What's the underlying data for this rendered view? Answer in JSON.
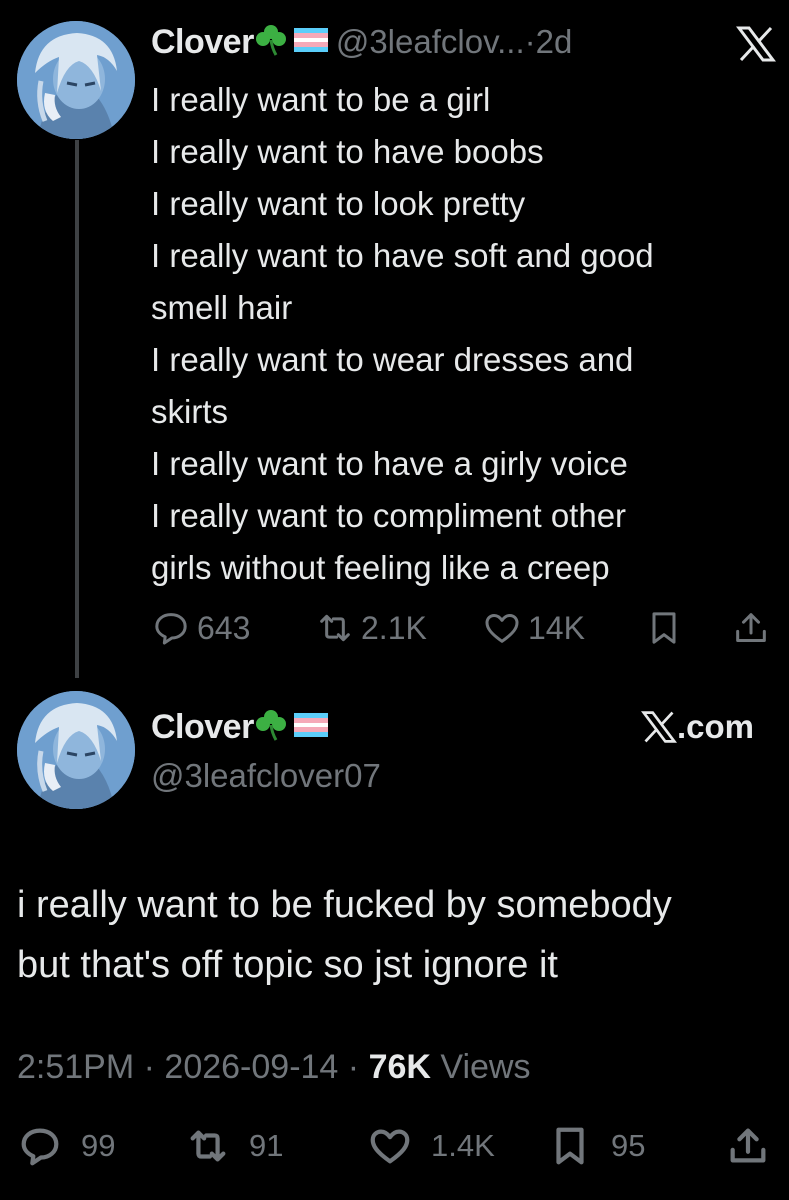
{
  "reply": {
    "author_name": "Clover",
    "handle": "@3leafclov...",
    "time": "2d",
    "lines": [
      "I really want to be a girl",
      "I really want to have boobs",
      "I really want to look pretty",
      "I really want to have soft and good",
      "smell hair",
      "I really want to wear dresses and",
      "skirts",
      "I really want to have a girly voice",
      "I really want to compliment other",
      "girls without feeling like a creep"
    ],
    "actions": {
      "replies": "643",
      "reposts": "2.1K",
      "likes": "14K"
    }
  },
  "main": {
    "author_name": "Clover",
    "handle": "@3leafclover07",
    "site_label": ".com",
    "lines": [
      "i really want to be fucked by somebody",
      "but that's off topic so jst ignore it"
    ],
    "time": "2:51PM",
    "date": "2026-09-14",
    "views_count": "76K",
    "views_label": "Views",
    "actions": {
      "replies": "99",
      "reposts": "91",
      "likes": "1.4K",
      "bookmarks": "95"
    }
  },
  "icons": {
    "reply": "speech-bubble-icon",
    "repost": "repost-arrows-icon",
    "like": "heart-icon",
    "bookmark": "bookmark-icon",
    "share": "share-icon",
    "brand": "x-logo-icon",
    "emoji": [
      "shamrock-icon",
      "trans-flag-icon"
    ]
  },
  "colors": {
    "background": "#000000",
    "text": "#e7e9ea",
    "muted": "#71767b",
    "thread_line": "#3e4144",
    "flag_blue": "#5bcefa",
    "flag_pink": "#f5a9b8",
    "shamrock": "#3cb043"
  }
}
